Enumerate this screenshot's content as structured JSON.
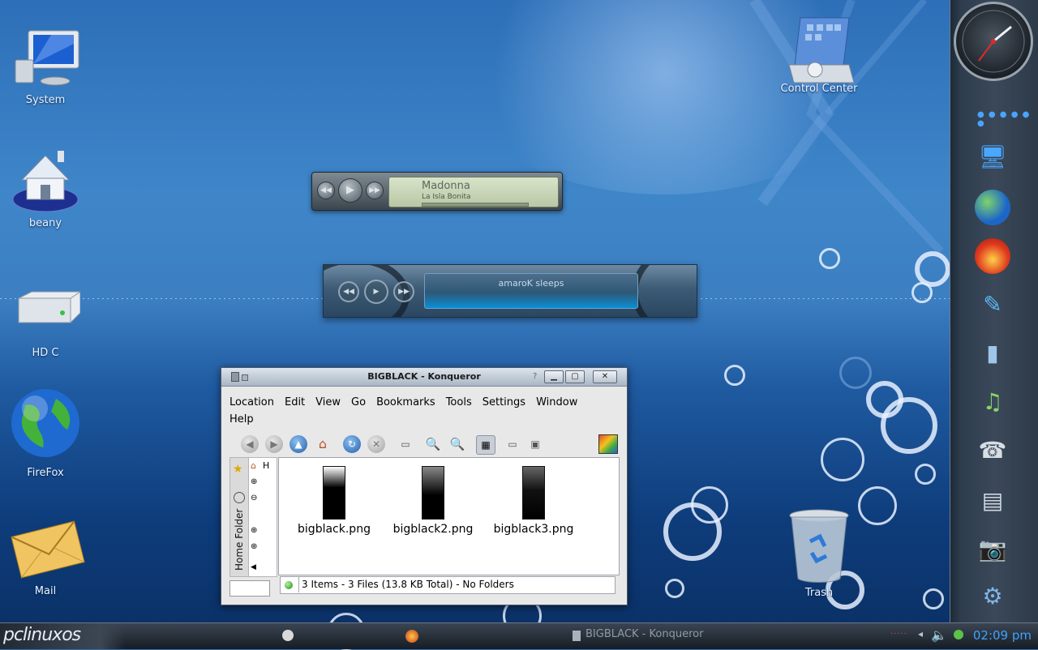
{
  "desktop": {
    "icons": [
      {
        "label": "System"
      },
      {
        "label": "beany"
      },
      {
        "label": "HD C"
      },
      {
        "label": "FireFox"
      },
      {
        "label": "Mail"
      },
      {
        "label": "Control Center"
      },
      {
        "label": "Trash"
      }
    ]
  },
  "player1": {
    "artist": "Madonna",
    "track": "La Isla Bonita"
  },
  "player2": {
    "status": "amaroK sleeps"
  },
  "window": {
    "title": "BIGBLACK - Konqueror",
    "help_glyph": "?",
    "menu": [
      "Location",
      "Edit",
      "View",
      "Go",
      "Bookmarks",
      "Tools",
      "Settings",
      "Window",
      "Help"
    ],
    "sidebar_tab": "Home Folder",
    "tree_label": "H",
    "files": [
      {
        "name": "bigblack.png"
      },
      {
        "name": "bigblack2.png"
      },
      {
        "name": "bigblack3.png"
      }
    ],
    "status": "3 Items - 3 Files (13.8 KB Total) - No Folders"
  },
  "taskbar": {
    "logo": "pclinuxos",
    "task_label": "BIGBLACK - Konqueror",
    "clock": "02:09 pm"
  },
  "colors": {
    "accent": "#3ea2ff",
    "desktop": "#3c7fc2"
  }
}
